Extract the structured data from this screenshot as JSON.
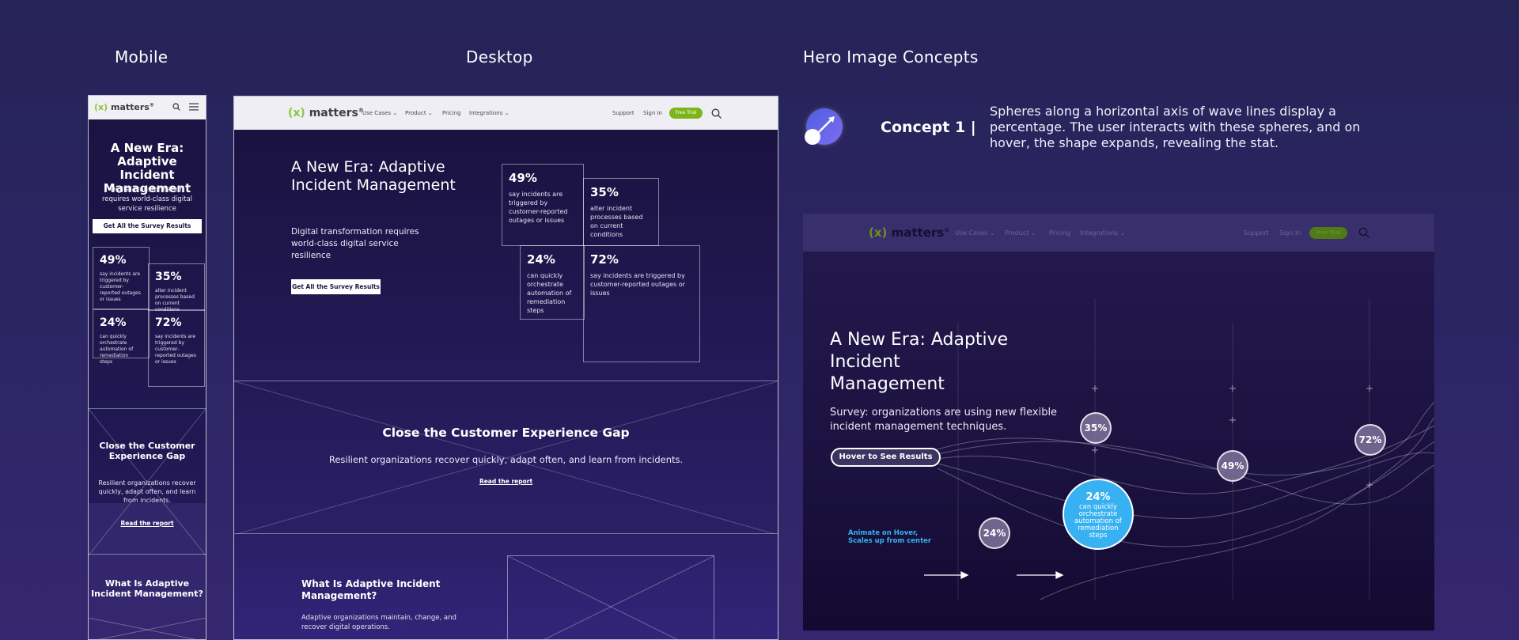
{
  "sections": {
    "mobile": "Mobile",
    "desktop": "Desktop",
    "concepts": "Hero Image Concepts"
  },
  "brand": {
    "logo_bracket": "(x)",
    "logo_word": "matters",
    "logo_mark": "®"
  },
  "nav": {
    "use_cases": "Use Cases",
    "product": "Product",
    "pricing": "Pricing",
    "integrations": "Integrations",
    "support": "Support",
    "sign_in": "Sign In",
    "free_trial": "Free Trial"
  },
  "hero": {
    "title": "A New Era: Adaptive Incident Management",
    "subtitle": "Digital transformation requires world-class digital service resilience",
    "cta": "Get All the Survey Results"
  },
  "stats": [
    {
      "pct": "49%",
      "text": "say incidents are triggered by customer-reported outages or issues"
    },
    {
      "pct": "35%",
      "text": "alter incident processes based on current conditions"
    },
    {
      "pct": "24%",
      "text": "can quickly orchestrate automation of remediation steps"
    },
    {
      "pct": "72%",
      "text": "say incidents are triggered by customer-reported outages or issues"
    }
  ],
  "cx": {
    "title": "Close the Customer Experience Gap",
    "text": "Resilient organizations recover quickly, adapt often, and learn from incidents.",
    "link": "Read the report"
  },
  "what": {
    "title": "What Is Adaptive Incident Management?",
    "text": "Adaptive organizations maintain, change, and recover digital operations."
  },
  "concept1": {
    "label": "Concept 1 |",
    "description": "Spheres along a horizontal axis of wave lines display a percentage. The user interacts with these spheres, and on hover, the shape expands, revealing the stat.",
    "title": "A New Era: Adaptive Incident Management",
    "subtitle": "Survey: organizations are using new flexible incident management techniques.",
    "hover_button": "Hover to See Results",
    "animate_note": "Animate on Hover, Scales up from center",
    "bubbles": {
      "b35": "35%",
      "b49": "49%",
      "b72": "72%",
      "b24_small": "24%",
      "b24_big_pct": "24%",
      "b24_big_text": "can quickly orchestrate automation of remediation steps"
    }
  },
  "colors": {
    "background": "#2a2460",
    "accent_green": "#7cb518",
    "accent_blue": "#37b1f2"
  }
}
